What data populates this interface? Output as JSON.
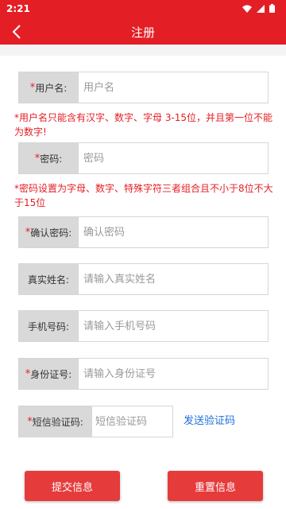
{
  "status_bar": {
    "time": "2:21"
  },
  "app_bar": {
    "title": "注册"
  },
  "form": {
    "username": {
      "required": "*",
      "label": "用户名:",
      "placeholder": "用户名"
    },
    "username_hint": "*用户名只能含有汉字、数字、字母 3-15位，并且第一位不能为数字!",
    "password": {
      "required": "*",
      "label": "密码:",
      "placeholder": "密码"
    },
    "password_hint": "*密码设置为字母、数字、特殊字符三者组合且不小于8位不大于15位",
    "confirm_password": {
      "required": "*",
      "label": "确认密码:",
      "placeholder": "确认密码"
    },
    "real_name": {
      "label": "真实姓名:",
      "placeholder": "请输入真实姓名"
    },
    "phone": {
      "label": "手机号码:",
      "placeholder": "请输入手机号码"
    },
    "id_card": {
      "required": "*",
      "label": "身份证号:",
      "placeholder": "请输入身份证号"
    },
    "sms_code": {
      "required": "*",
      "label": "短信验证码:",
      "placeholder": "短信验证码"
    },
    "send_code": "发送验证码"
  },
  "buttons": {
    "submit": "提交信息",
    "reset": "重置信息"
  },
  "colors": {
    "primary": "#e41e25",
    "link": "#1e6fd9",
    "label_bg": "#d9d9d9"
  },
  "icons": [
    "wifi-icon",
    "signal-icon",
    "battery-icon",
    "back-arrow-icon"
  ]
}
